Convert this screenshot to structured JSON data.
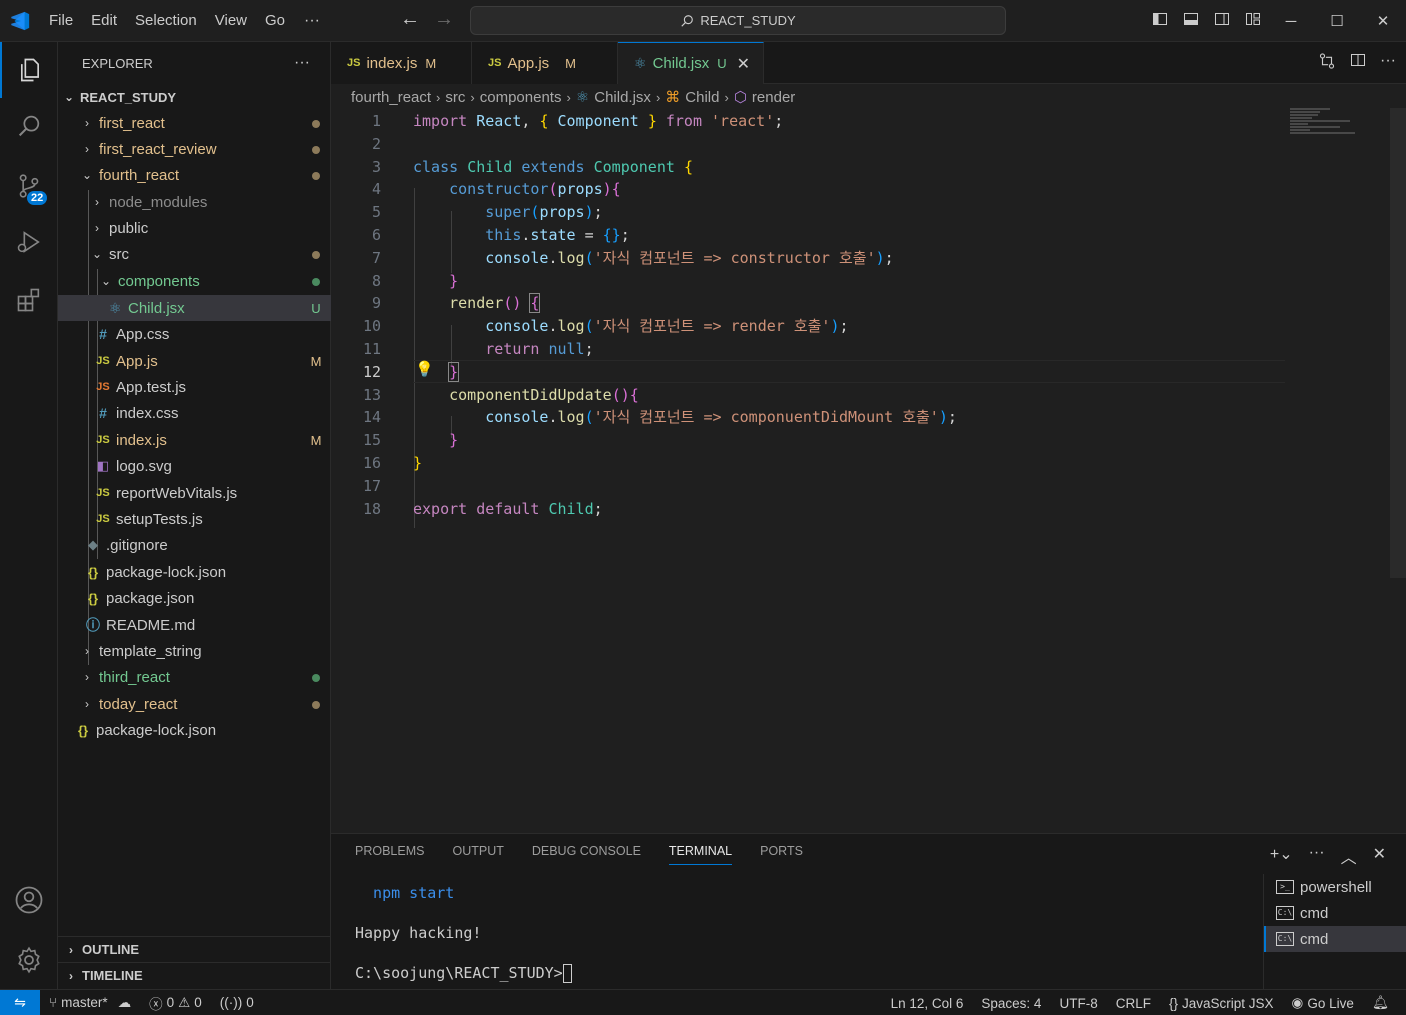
{
  "titlebar": {
    "menu": [
      "File",
      "Edit",
      "Selection",
      "View",
      "Go"
    ],
    "more": "···",
    "search_text": "REACT_STUDY"
  },
  "activity": {
    "source_control_badge": "22"
  },
  "explorer": {
    "title": "EXPLORER",
    "more": "···",
    "root": "REACT_STUDY",
    "items": [
      {
        "label": "first_react",
        "status": "dot"
      },
      {
        "label": "first_react_review",
        "status": "dot"
      },
      {
        "label": "fourth_react",
        "status": "dot"
      },
      {
        "label": "node_modules",
        "status": ""
      },
      {
        "label": "public",
        "status": ""
      },
      {
        "label": "src",
        "status": "dot"
      },
      {
        "label": "components",
        "status": "dot"
      },
      {
        "label": "Child.jsx",
        "status": "U"
      },
      {
        "label": "App.css",
        "status": ""
      },
      {
        "label": "App.js",
        "status": "M"
      },
      {
        "label": "App.test.js",
        "status": ""
      },
      {
        "label": "index.css",
        "status": ""
      },
      {
        "label": "index.js",
        "status": "M"
      },
      {
        "label": "logo.svg",
        "status": ""
      },
      {
        "label": "reportWebVitals.js",
        "status": ""
      },
      {
        "label": "setupTests.js",
        "status": ""
      },
      {
        "label": ".gitignore",
        "status": ""
      },
      {
        "label": "package-lock.json",
        "status": ""
      },
      {
        "label": "package.json",
        "status": ""
      },
      {
        "label": "README.md",
        "status": ""
      },
      {
        "label": "template_string",
        "status": ""
      },
      {
        "label": "third_react",
        "status": "dot"
      },
      {
        "label": "today_react",
        "status": "dot"
      },
      {
        "label": "package-lock.json",
        "status": ""
      }
    ],
    "outline": "OUTLINE",
    "timeline": "TIMELINE"
  },
  "tabs": [
    {
      "icon": "JS",
      "label": "index.js",
      "status": "M"
    },
    {
      "icon": "JS",
      "label": "App.js",
      "status": "M"
    },
    {
      "icon": "react",
      "label": "Child.jsx",
      "status": "U"
    }
  ],
  "breadcrumb": [
    "fourth_react",
    "src",
    "components",
    "Child.jsx",
    "Child",
    "render"
  ],
  "editor": {
    "current_line": 12,
    "line_numbers": [
      "1",
      "2",
      "3",
      "4",
      "5",
      "6",
      "7",
      "8",
      "9",
      "10",
      "11",
      "12",
      "13",
      "14",
      "15",
      "16",
      "17",
      "18"
    ],
    "str_constructor": "'자식 컴포넌트 => constructor 호출'",
    "str_render": "'자식 컴포넌트 => render 호출'",
    "str_didupdate": "'자식 컴포넌트 => componuentDidMount 호출'",
    "str_react": "'react'"
  },
  "panel": {
    "tabs": [
      "PROBLEMS",
      "OUTPUT",
      "DEBUG CONSOLE",
      "TERMINAL",
      "PORTS"
    ],
    "active_tab": "TERMINAL",
    "terminal_lines": [
      "  npm start",
      "Happy hacking!",
      "C:\\soojung\\REACT_STUDY>"
    ],
    "terminals": [
      "powershell",
      "cmd",
      "cmd"
    ],
    "more": "···"
  },
  "statusbar": {
    "branch": "master*",
    "errors": "0",
    "warnings": "0",
    "ports": "0",
    "position": "Ln 12, Col 6",
    "spaces": "Spaces: 4",
    "encoding": "UTF-8",
    "eol": "CRLF",
    "language": "JavaScript JSX",
    "golive": "Go Live"
  },
  "colors": {
    "accent": "#0078d4",
    "modified": "#e2c08d",
    "untracked": "#73c991"
  }
}
